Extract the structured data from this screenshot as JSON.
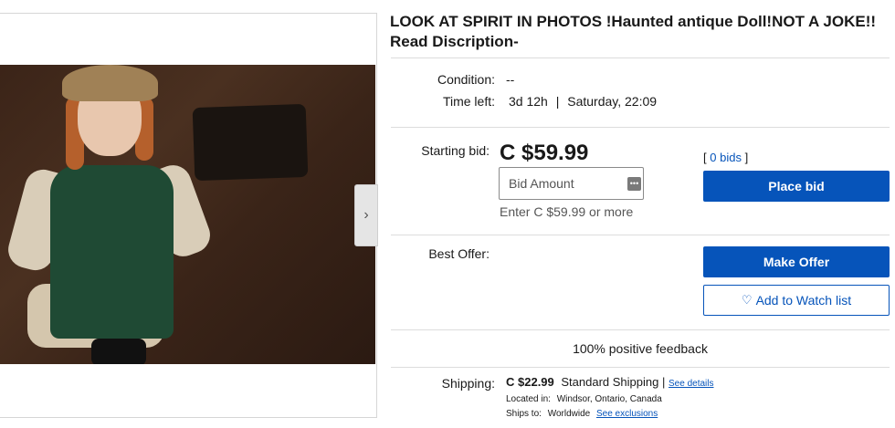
{
  "listing": {
    "title": "LOOK AT SPIRIT IN PHOTOS !Haunted antique Doll!NOT A JOKE!! Read Discription-"
  },
  "gallery": {
    "next_arrow": "›"
  },
  "condition": {
    "label": "Condition:",
    "value": "--"
  },
  "time_left": {
    "label": "Time left:",
    "value": "3d 12h",
    "separator": "|",
    "end": "Saturday, 22:09"
  },
  "bid": {
    "label": "Starting bid:",
    "price": "C $59.99",
    "input_placeholder": "Bid Amount",
    "hint": "Enter C $59.99 or more",
    "bids_open": "[",
    "bids_link": "0 bids",
    "bids_close": "]",
    "place_bid": "Place bid"
  },
  "offer": {
    "label": "Best Offer:",
    "make_offer": "Make Offer",
    "watch": "Add to Watch list"
  },
  "feedback": "100% positive feedback",
  "shipping": {
    "label": "Shipping:",
    "cost": "C $22.99",
    "method": "Standard Shipping",
    "sep": "|",
    "details_link": "See details",
    "located_label": "Located in:",
    "located_value": "Windsor, Ontario, Canada",
    "ships_label": "Ships to:",
    "ships_value": "Worldwide",
    "exclusions_link": "See exclusions"
  },
  "colors": {
    "primary": "#0654ba",
    "text": "#191919",
    "muted": "#555555"
  },
  "icons": {
    "dots": "more-options-icon",
    "heart": "heart-icon",
    "arrow": "chevron-right-icon"
  }
}
